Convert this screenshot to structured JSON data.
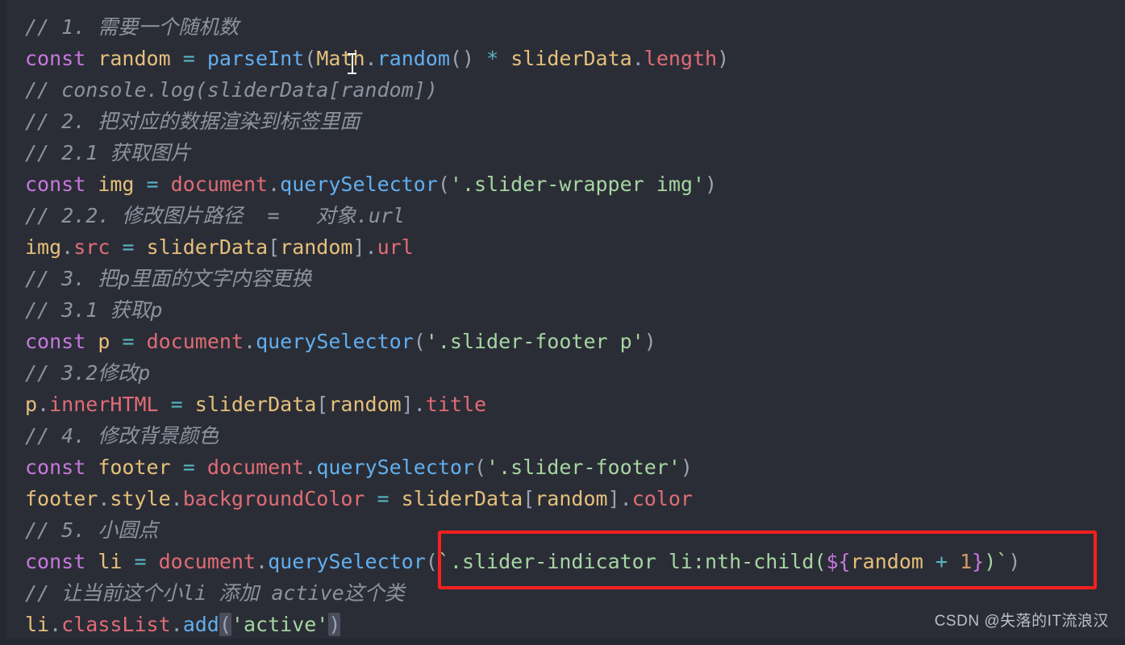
{
  "editor": {
    "theme_background": "#2b2d36",
    "language": "javascript",
    "colors": {
      "comment": "#8b949e",
      "keyword": "#c678dd",
      "variable": "#e5c07b",
      "operator": "#56b6c2",
      "function": "#61afef",
      "object": "#e06c75",
      "property": "#e06c75",
      "string": "#a5d6a2",
      "punctuation": "#9aa3b2",
      "number": "#d19a66",
      "template_marker": "#c678dd",
      "annotation_box": "#fb1f1f"
    }
  },
  "code": {
    "lines": [
      {
        "id": "l1",
        "text": "// 1. 需要一个随机数"
      },
      {
        "id": "l2",
        "text": "const random = parseInt(Math.random() * sliderData.length)"
      },
      {
        "id": "l3",
        "text": "// console.log(sliderData[random])"
      },
      {
        "id": "l4",
        "text": "// 2. 把对应的数据渲染到标签里面"
      },
      {
        "id": "l5",
        "text": "// 2.1 获取图片"
      },
      {
        "id": "l6",
        "text": "const img = document.querySelector('.slider-wrapper img')"
      },
      {
        "id": "l7",
        "text": "// 2.2. 修改图片路径  =   对象.url"
      },
      {
        "id": "l8",
        "text": "img.src = sliderData[random].url"
      },
      {
        "id": "l9",
        "text": "// 3. 把p里面的文字内容更换"
      },
      {
        "id": "l10",
        "text": "// 3.1 获取p"
      },
      {
        "id": "l11",
        "text": "const p = document.querySelector('.slider-footer p')"
      },
      {
        "id": "l12",
        "text": "// 3.2修改p"
      },
      {
        "id": "l13",
        "text": "p.innerHTML = sliderData[random].title"
      },
      {
        "id": "l14",
        "text": "// 4. 修改背景颜色"
      },
      {
        "id": "l15",
        "text": "const footer = document.querySelector('.slider-footer')"
      },
      {
        "id": "l16",
        "text": "footer.style.backgroundColor = sliderData[random].color"
      },
      {
        "id": "l17",
        "text": "// 5. 小圆点"
      },
      {
        "id": "l18",
        "text": "const li = document.querySelector(`.slider-indicator li:nth-child(${random + 1})`)"
      },
      {
        "id": "l19",
        "text": "// 让当前这个小li 添加 active这个类"
      },
      {
        "id": "l20",
        "text": "li.classList.add('active')"
      }
    ],
    "tokens": {
      "kw_const": "const",
      "var_random": "random",
      "var_img": "img",
      "var_p": "p",
      "var_footer": "footer",
      "var_li": "li",
      "fn_parseInt": "parseInt",
      "obj_Math": "Math",
      "fn_random": "random",
      "obj_sliderData": "sliderData",
      "prop_length": "length",
      "obj_document": "document",
      "fn_querySelector": "querySelector",
      "prop_src": "src",
      "prop_url": "url",
      "prop_innerHTML": "innerHTML",
      "prop_title": "title",
      "prop_style": "style",
      "prop_backgroundColor": "backgroundColor",
      "prop_color": "color",
      "prop_classList": "classList",
      "fn_add": "add",
      "str_wrapper_img": "'.slider-wrapper img'",
      "str_footer_p": "'.slider-footer p'",
      "str_footer": "'.slider-footer'",
      "str_active": "'active'",
      "tpl_indicator": ".slider-indicator li:nth-child(",
      "tpl_expr_random": "random",
      "tpl_expr_plus": "+",
      "tpl_expr_one": "1"
    }
  },
  "annotation": {
    "box_label": "highlighted-code-region",
    "color": "#fb1f1f"
  },
  "watermark": {
    "text": "CSDN @失落的IT流浪汉"
  }
}
